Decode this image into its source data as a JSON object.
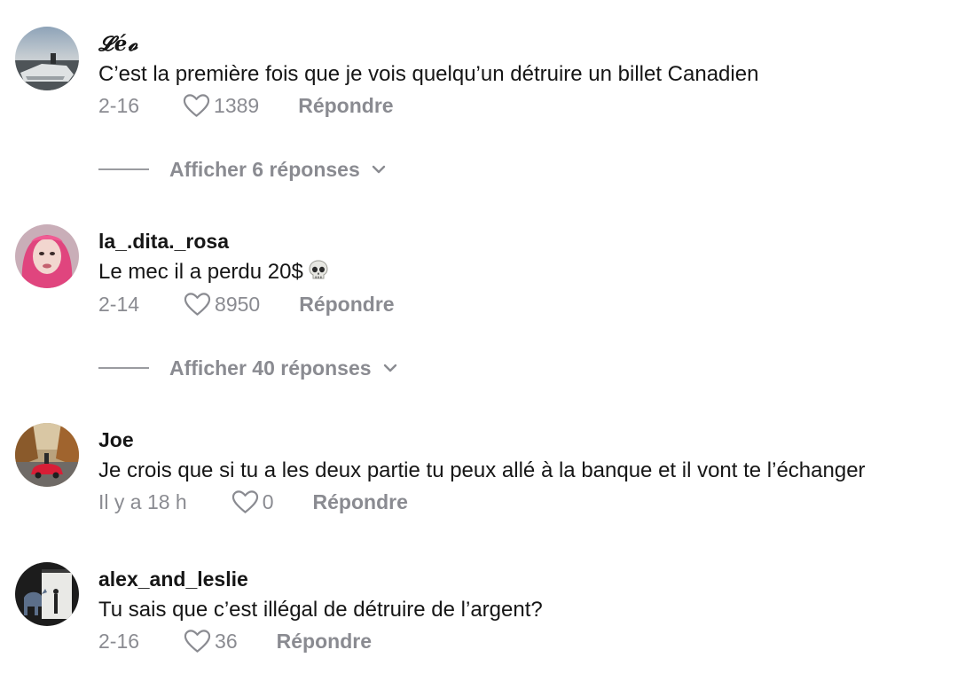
{
  "comments": [
    {
      "username": "𝓛é𝓸",
      "text": "C’est la première fois que je vois quelqu’un détruire un billet Canadien",
      "date": "2-16",
      "likes": "1389",
      "reply_label": "Répondre",
      "view_replies": "Afficher 6 réponses"
    },
    {
      "username": "la_.dita._rosa",
      "text": "Le mec il a perdu 20$",
      "date": "2-14",
      "likes": "8950",
      "reply_label": "Répondre",
      "view_replies": "Afficher 40 réponses"
    },
    {
      "username": "Joe",
      "text": "Je crois que si tu a les deux partie tu peux allé à la banque et il vont te l’échanger",
      "date": "Il y a 18 h",
      "likes": "0",
      "reply_label": "Répondre"
    },
    {
      "username": "alex_and_leslie",
      "text": "Tu sais que c’est illégal de détruire de l’argent?",
      "date": "2-16",
      "likes": "36",
      "reply_label": "Répondre"
    }
  ],
  "icons": {
    "like": "heart-outline-icon",
    "expand": "chevron-down-icon",
    "emoji": "skull-emoji"
  },
  "colors": {
    "text": "#161616",
    "muted": "#8a8b91"
  }
}
